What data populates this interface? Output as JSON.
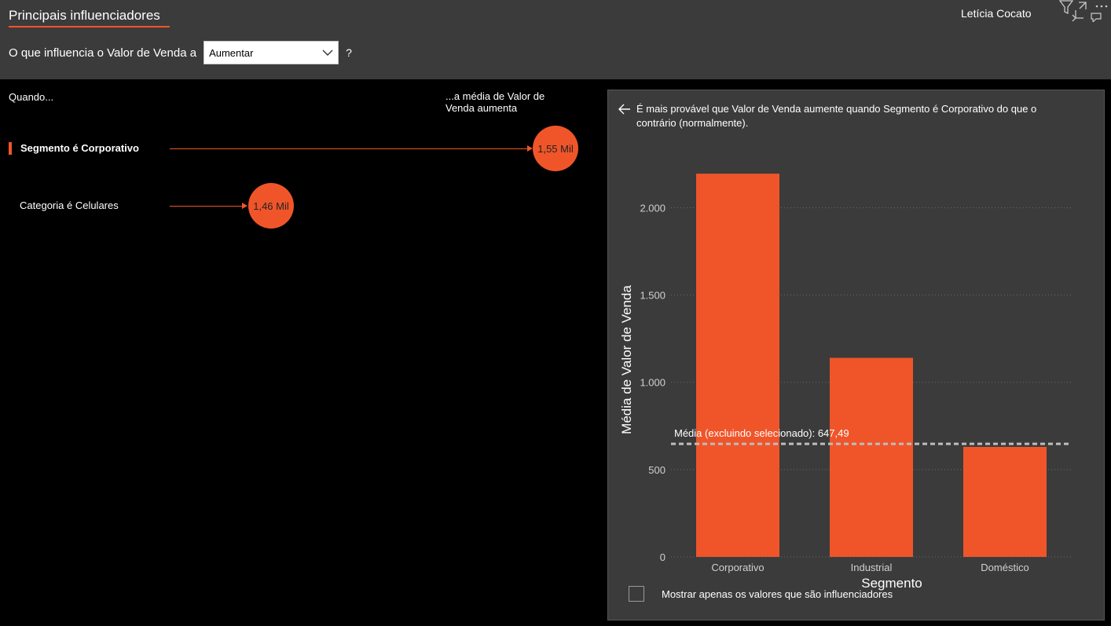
{
  "header": {
    "title": "Principais influenciadores",
    "user_name": "Letícia Cocato",
    "question_prefix": "O que influencia o Valor de Venda a",
    "dropdown_value": "Aumentar",
    "question_suffix": "?",
    "icons": [
      "filter-icon",
      "expand-icon",
      "more-options-icon"
    ]
  },
  "left": {
    "col_when": "Quando...",
    "col_avg": "...a média de Valor de Venda aumenta",
    "influencers": [
      {
        "label": "Segmento é Corporativo",
        "value": "1,55 Mil",
        "selected": true
      },
      {
        "label": "Categoria é Celulares",
        "value": "1,46 Mil",
        "selected": false
      }
    ]
  },
  "right": {
    "explanation": "É mais provável que Valor de Venda aumente quando Segmento é Corporativo do que o contrário (normalmente).",
    "checkbox_label": "Mostrar apenas os valores que são influenciadores",
    "checkbox_checked": false
  },
  "chart_data": {
    "type": "bar",
    "categories": [
      "Corporativo",
      "Industrial",
      "Doméstico"
    ],
    "values": [
      2195,
      1140,
      630
    ],
    "xlabel": "Segmento",
    "ylabel": "Média de Valor de Venda",
    "yticks": [
      0,
      500,
      1000,
      1500,
      2000
    ],
    "ytick_labels": [
      "0",
      "500",
      "1.000",
      "1.500",
      "2.000"
    ],
    "ylim": [
      0,
      2290
    ],
    "grid": true,
    "reference_line": {
      "label": "Média (excluindo selecionado): 647,49",
      "value": 647.49
    },
    "colors": {
      "bar": "#f0552a",
      "grid": "#6a6a6a",
      "reference": "#bdbdbd"
    }
  }
}
